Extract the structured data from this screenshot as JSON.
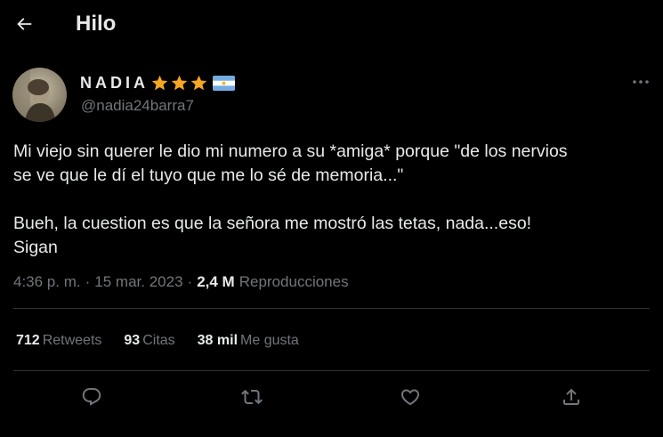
{
  "header": {
    "title": "Hilo",
    "back_icon": "arrow-left-icon"
  },
  "author": {
    "display_name": "NADIA",
    "star_count": 3,
    "star_color": "#f5a623",
    "flag": "argentina-flag",
    "handle": "@nadia24barra7"
  },
  "tweet": {
    "paragraph_1": "Mi viejo sin querer le dio mi numero a su *amiga* porque \"de los nervios\nse ve que le dí el tuyo que me lo sé de memoria...\"",
    "paragraph_2": "Bueh, la cuestion es que la señora me mostró las tetas, nada...eso!\nSigan"
  },
  "meta": {
    "time": "4:36 p. m.",
    "separator_1": "·",
    "date": "15 mar. 2023",
    "separator_2": "·",
    "views_count": "2,4 M",
    "views_label": "Reproducciones"
  },
  "stats": {
    "retweets_count": "712",
    "retweets_label": "Retweets",
    "quotes_count": "93",
    "quotes_label": "Citas",
    "likes_count": "38 mil",
    "likes_label": "Me gusta"
  },
  "actions": {
    "reply_icon": "reply-icon",
    "retweet_icon": "retweet-icon",
    "like_icon": "heart-icon",
    "share_icon": "share-icon"
  },
  "colors": {
    "background": "#000000",
    "text_primary": "#e7e9ea",
    "text_secondary": "#71767b",
    "divider": "#2f3336"
  }
}
